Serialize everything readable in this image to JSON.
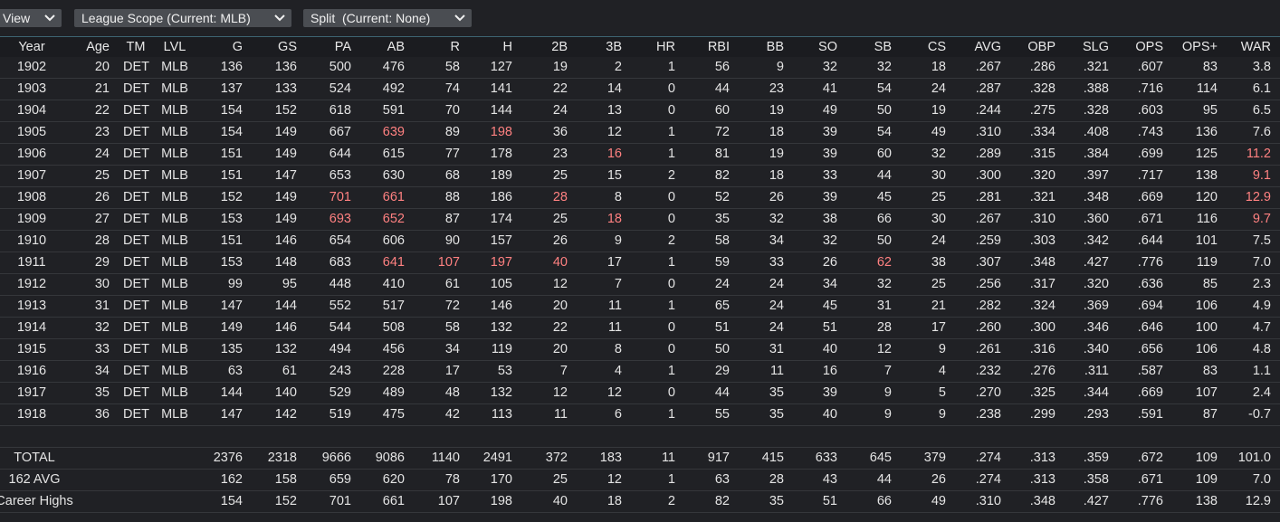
{
  "toolbar": {
    "view_label": "View",
    "league_label": "League Scope (Current: MLB)",
    "split_label": "Split  (Current: None)"
  },
  "columns": [
    "Year",
    "Age",
    "TM",
    "LVL",
    "G",
    "GS",
    "PA",
    "AB",
    "R",
    "H",
    "2B",
    "3B",
    "HR",
    "RBI",
    "BB",
    "SO",
    "SB",
    "CS",
    "AVG",
    "OBP",
    "SLG",
    "OPS",
    "OPS+",
    "WAR"
  ],
  "highlight_color": "#ff8181",
  "rows": [
    {
      "cells": [
        "1902",
        "20",
        "DET",
        "MLB",
        "136",
        "136",
        "500",
        "476",
        "58",
        "127",
        "19",
        "2",
        "1",
        "56",
        "9",
        "32",
        "32",
        "18",
        ".267",
        ".286",
        ".321",
        ".607",
        "83",
        "3.8"
      ],
      "hl": []
    },
    {
      "cells": [
        "1903",
        "21",
        "DET",
        "MLB",
        "137",
        "133",
        "524",
        "492",
        "74",
        "141",
        "22",
        "14",
        "0",
        "44",
        "23",
        "41",
        "54",
        "24",
        ".287",
        ".328",
        ".388",
        ".716",
        "114",
        "6.1"
      ],
      "hl": []
    },
    {
      "cells": [
        "1904",
        "22",
        "DET",
        "MLB",
        "154",
        "152",
        "618",
        "591",
        "70",
        "144",
        "24",
        "13",
        "0",
        "60",
        "19",
        "49",
        "50",
        "19",
        ".244",
        ".275",
        ".328",
        ".603",
        "95",
        "6.5"
      ],
      "hl": []
    },
    {
      "cells": [
        "1905",
        "23",
        "DET",
        "MLB",
        "154",
        "149",
        "667",
        "639",
        "89",
        "198",
        "36",
        "12",
        "1",
        "72",
        "18",
        "39",
        "54",
        "49",
        ".310",
        ".334",
        ".408",
        ".743",
        "136",
        "7.6"
      ],
      "hl": [
        7,
        9
      ]
    },
    {
      "cells": [
        "1906",
        "24",
        "DET",
        "MLB",
        "151",
        "149",
        "644",
        "615",
        "77",
        "178",
        "23",
        "16",
        "1",
        "81",
        "19",
        "39",
        "60",
        "32",
        ".289",
        ".315",
        ".384",
        ".699",
        "125",
        "11.2"
      ],
      "hl": [
        11,
        23
      ]
    },
    {
      "cells": [
        "1907",
        "25",
        "DET",
        "MLB",
        "151",
        "147",
        "653",
        "630",
        "68",
        "189",
        "25",
        "15",
        "2",
        "82",
        "18",
        "33",
        "44",
        "30",
        ".300",
        ".320",
        ".397",
        ".717",
        "138",
        "9.1"
      ],
      "hl": [
        23
      ]
    },
    {
      "cells": [
        "1908",
        "26",
        "DET",
        "MLB",
        "152",
        "149",
        "701",
        "661",
        "88",
        "186",
        "28",
        "8",
        "0",
        "52",
        "26",
        "39",
        "45",
        "25",
        ".281",
        ".321",
        ".348",
        ".669",
        "120",
        "12.9"
      ],
      "hl": [
        6,
        7,
        10,
        23
      ]
    },
    {
      "cells": [
        "1909",
        "27",
        "DET",
        "MLB",
        "153",
        "149",
        "693",
        "652",
        "87",
        "174",
        "25",
        "18",
        "0",
        "35",
        "32",
        "38",
        "66",
        "30",
        ".267",
        ".310",
        ".360",
        ".671",
        "116",
        "9.7"
      ],
      "hl": [
        6,
        7,
        11,
        23
      ]
    },
    {
      "cells": [
        "1910",
        "28",
        "DET",
        "MLB",
        "151",
        "146",
        "654",
        "606",
        "90",
        "157",
        "26",
        "9",
        "2",
        "58",
        "34",
        "32",
        "50",
        "24",
        ".259",
        ".303",
        ".342",
        ".644",
        "101",
        "7.5"
      ],
      "hl": []
    },
    {
      "cells": [
        "1911",
        "29",
        "DET",
        "MLB",
        "153",
        "148",
        "683",
        "641",
        "107",
        "197",
        "40",
        "17",
        "1",
        "59",
        "33",
        "26",
        "62",
        "38",
        ".307",
        ".348",
        ".427",
        ".776",
        "119",
        "7.0"
      ],
      "hl": [
        7,
        8,
        9,
        10,
        16
      ]
    },
    {
      "cells": [
        "1912",
        "30",
        "DET",
        "MLB",
        "99",
        "95",
        "448",
        "410",
        "61",
        "105",
        "12",
        "7",
        "0",
        "24",
        "24",
        "34",
        "32",
        "25",
        ".256",
        ".317",
        ".320",
        ".636",
        "85",
        "2.3"
      ],
      "hl": []
    },
    {
      "cells": [
        "1913",
        "31",
        "DET",
        "MLB",
        "147",
        "144",
        "552",
        "517",
        "72",
        "146",
        "20",
        "11",
        "1",
        "65",
        "24",
        "45",
        "31",
        "21",
        ".282",
        ".324",
        ".369",
        ".694",
        "106",
        "4.9"
      ],
      "hl": []
    },
    {
      "cells": [
        "1914",
        "32",
        "DET",
        "MLB",
        "149",
        "146",
        "544",
        "508",
        "58",
        "132",
        "22",
        "11",
        "0",
        "51",
        "24",
        "51",
        "28",
        "17",
        ".260",
        ".300",
        ".346",
        ".646",
        "100",
        "4.7"
      ],
      "hl": []
    },
    {
      "cells": [
        "1915",
        "33",
        "DET",
        "MLB",
        "135",
        "132",
        "494",
        "456",
        "34",
        "119",
        "20",
        "8",
        "0",
        "50",
        "31",
        "40",
        "12",
        "9",
        ".261",
        ".316",
        ".340",
        ".656",
        "106",
        "4.8"
      ],
      "hl": []
    },
    {
      "cells": [
        "1916",
        "34",
        "DET",
        "MLB",
        "63",
        "61",
        "243",
        "228",
        "17",
        "53",
        "7",
        "4",
        "1",
        "29",
        "11",
        "16",
        "7",
        "4",
        ".232",
        ".276",
        ".311",
        ".587",
        "83",
        "1.1"
      ],
      "hl": []
    },
    {
      "cells": [
        "1917",
        "35",
        "DET",
        "MLB",
        "144",
        "140",
        "529",
        "489",
        "48",
        "132",
        "12",
        "12",
        "0",
        "44",
        "35",
        "39",
        "9",
        "5",
        ".270",
        ".325",
        ".344",
        ".669",
        "107",
        "2.4"
      ],
      "hl": []
    },
    {
      "cells": [
        "1918",
        "36",
        "DET",
        "MLB",
        "147",
        "142",
        "519",
        "475",
        "42",
        "113",
        "11",
        "6",
        "1",
        "55",
        "35",
        "40",
        "9",
        "9",
        ".238",
        ".299",
        ".293",
        ".591",
        "87",
        "-0.7"
      ],
      "hl": []
    }
  ],
  "summary": [
    {
      "label": "TOTAL",
      "cells": [
        "2376",
        "2318",
        "9666",
        "9086",
        "1140",
        "2491",
        "372",
        "183",
        "11",
        "917",
        "415",
        "633",
        "645",
        "379",
        ".274",
        ".313",
        ".359",
        ".672",
        "109",
        "101.0"
      ]
    },
    {
      "label": "162 AVG",
      "cells": [
        "162",
        "158",
        "659",
        "620",
        "78",
        "170",
        "25",
        "12",
        "1",
        "63",
        "28",
        "43",
        "44",
        "26",
        ".274",
        ".313",
        ".358",
        ".671",
        "109",
        "7.0"
      ]
    },
    {
      "label": "Career Highs",
      "cells": [
        "154",
        "152",
        "701",
        "661",
        "107",
        "198",
        "40",
        "18",
        "2",
        "82",
        "35",
        "51",
        "66",
        "49",
        ".310",
        ".348",
        ".427",
        ".776",
        "138",
        "12.9"
      ]
    }
  ]
}
